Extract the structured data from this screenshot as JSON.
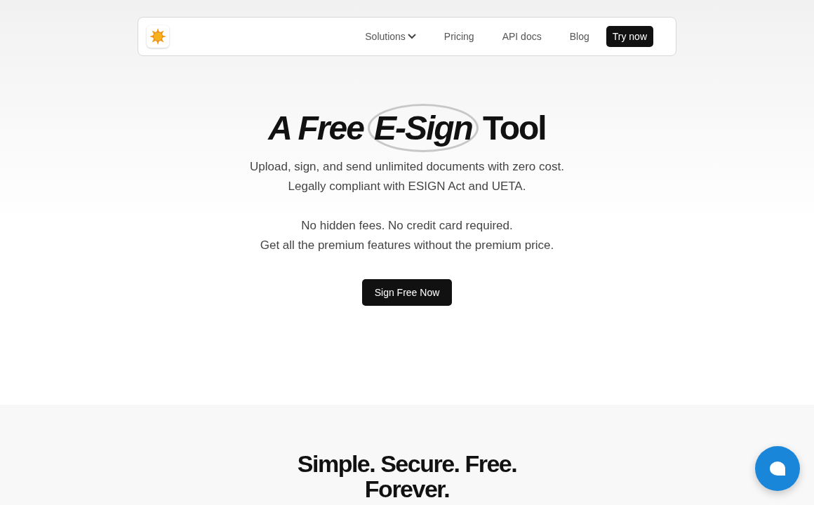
{
  "nav": {
    "links": [
      {
        "label": "Solutions",
        "dropdown": true
      },
      {
        "label": "Pricing",
        "dropdown": false
      },
      {
        "label": "API docs",
        "dropdown": false
      },
      {
        "label": "Blog",
        "dropdown": false
      }
    ],
    "cta": "Try now"
  },
  "hero": {
    "title_start": "A Free",
    "title_circled": "E-Sign",
    "title_end": "Tool",
    "lines": [
      "Upload, sign, and send unlimited documents with zero cost.",
      "Legally compliant with ESIGN Act and UETA."
    ],
    "lines2": [
      "No hidden fees. No credit card required.",
      "Get all the premium features without the premium price."
    ],
    "button": "Sign Free Now"
  },
  "section": {
    "heading": "Simple. Secure. Free. Forever."
  }
}
